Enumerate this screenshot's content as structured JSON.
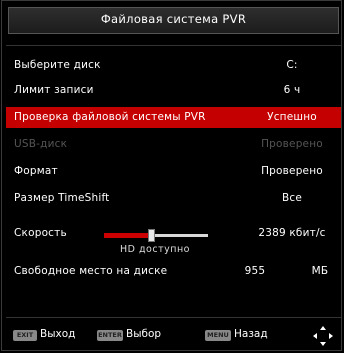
{
  "title": "Файловая система PVR",
  "rows": {
    "disk": {
      "label": "Выберите диск",
      "value": "C:"
    },
    "limit": {
      "label": "Лимит записи",
      "value": "6 ч"
    },
    "check": {
      "label": "Проверка файловой системы PVR",
      "value": "Успешно"
    },
    "usb": {
      "label": "USB-диск",
      "value": "Проверено"
    },
    "format": {
      "label": "Формат",
      "value": "Проверено"
    },
    "timeshift": {
      "label": "Размер TimeShift",
      "value": "Все"
    },
    "speed": {
      "label": "Скорость",
      "value": "2389 кбит/с",
      "note": "HD доступно",
      "level": 0.45
    },
    "free": {
      "label": "Свободное место на диске",
      "value": "955",
      "unit": "МБ"
    }
  },
  "footer": {
    "exit_key": "EXIT",
    "exit_label": "Выход",
    "enter_key": "ENTER",
    "enter_label": "Выбор",
    "menu_key": "MENU",
    "menu_label": "Назад"
  },
  "colors": {
    "highlight": "#c40000",
    "disabled": "#555555"
  },
  "icons": {
    "nav": "arrow-keys-icon"
  }
}
